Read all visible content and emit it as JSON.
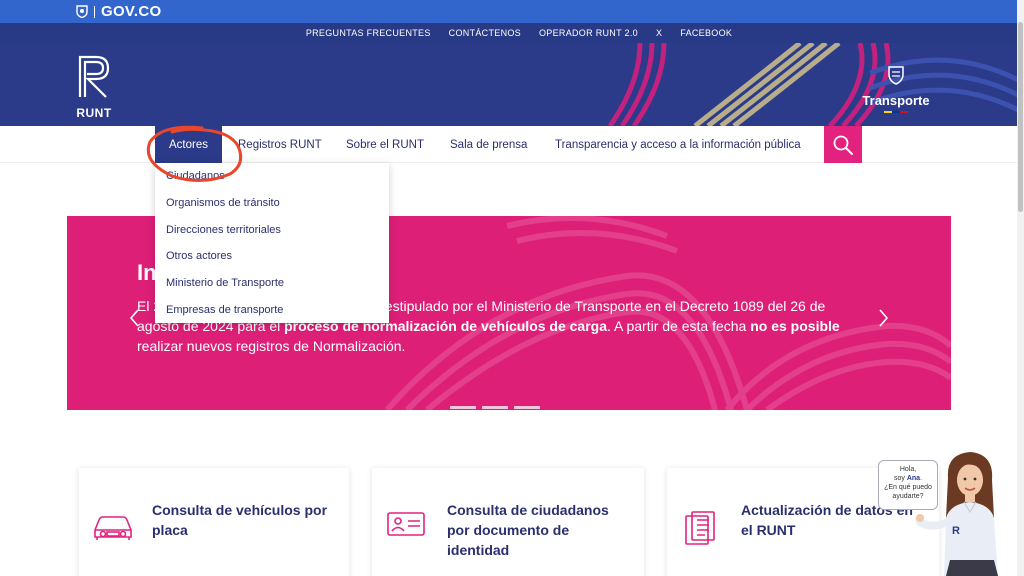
{
  "gov": {
    "logo_text": "GOV.CO"
  },
  "toplinks": [
    "PREGUNTAS FRECUENTES",
    "CONTÁCTENOS",
    "OPERADOR RUNT 2.0",
    "X",
    "FACEBOOK"
  ],
  "header": {
    "runt_label": "RUNT",
    "ministry_label": "Transporte"
  },
  "nav": {
    "items": [
      "Actores",
      "Registros RUNT",
      "Sobre el RUNT",
      "Sala de prensa",
      "Transparencia y acceso a la información pública"
    ],
    "active": "Actores"
  },
  "dropdown": {
    "items": [
      "Ciudadanos",
      "Organismos de tránsito",
      "Direcciones territoriales",
      "Otros actores",
      "Ministerio de Transporte",
      "Empresas de transporte"
    ]
  },
  "banner": {
    "title_partial": "In",
    "line1_start": "El 2",
    "line1_end": "o estipulado por el Ministerio de Transporte en el Decreto 1089 del 26 de",
    "line2_plain": "agosto de 2024 para el ",
    "line2_bold": "proceso de normalización de vehículos de carga",
    "line2_tail": ". A partir de esta fecha ",
    "line2_bold2": "no es posible",
    "line3": "realizar nuevos registros de Normalización."
  },
  "cards": [
    {
      "title": "Consulta de vehículos por placa",
      "icon": "car-icon"
    },
    {
      "title": "Consulta de ciudadanos por documento de identidad",
      "icon": "id-card-icon"
    },
    {
      "title": "Actualización de datos en el RUNT",
      "icon": "document-icon"
    }
  ],
  "assistant": {
    "line1": "Hola,",
    "line2a": "soy ",
    "name": "Ana",
    "line3": "¿En qué puedo ayudarte?"
  },
  "colors": {
    "gov_blue": "#3366cc",
    "runt_navy": "#2b3b89",
    "magenta": "#dd1f78",
    "search_pink": "#e2227e"
  }
}
